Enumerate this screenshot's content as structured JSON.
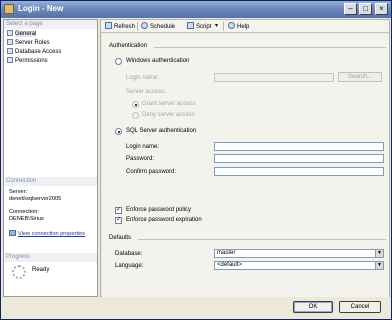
{
  "window": {
    "title": "Login - New"
  },
  "left_pane": {
    "select_page_header": "Select a page",
    "pages": [
      "General",
      "Server Roles",
      "Database Access",
      "Permissions"
    ],
    "connection_header": "Connection",
    "server_label": "Server:",
    "server_value": "deneb\\sqlserver2005",
    "connection_label": "Connection:",
    "connection_value": "DENEB\\Sirius",
    "view_connection_link": "View connection properties",
    "progress_header": "Progress",
    "progress_status": "Ready"
  },
  "toolbar": {
    "refresh": "Refresh",
    "schedule": "Schedule",
    "script": "Script",
    "help": "Help"
  },
  "authentication": {
    "group_label": "Authentication",
    "windows_auth": "Windows authentication",
    "login_name_label": "Login name:",
    "search_button": "Search...",
    "server_access_label": "Server access:",
    "grant_access": "Grant server access",
    "deny_access": "Deny server access",
    "sql_auth": "SQL Server authentication",
    "sql_login_label": "Login name:",
    "password_label": "Password:",
    "confirm_password_label": "Confirm password:",
    "enforce_policy": "Enforce password policy",
    "enforce_expiration": "Enforce password expiration"
  },
  "defaults": {
    "group_label": "Defaults",
    "database_label": "Database:",
    "database_value": "master",
    "language_label": "Language:",
    "language_value": "<default>"
  },
  "footer": {
    "ok": "OK",
    "cancel": "Cancel"
  }
}
